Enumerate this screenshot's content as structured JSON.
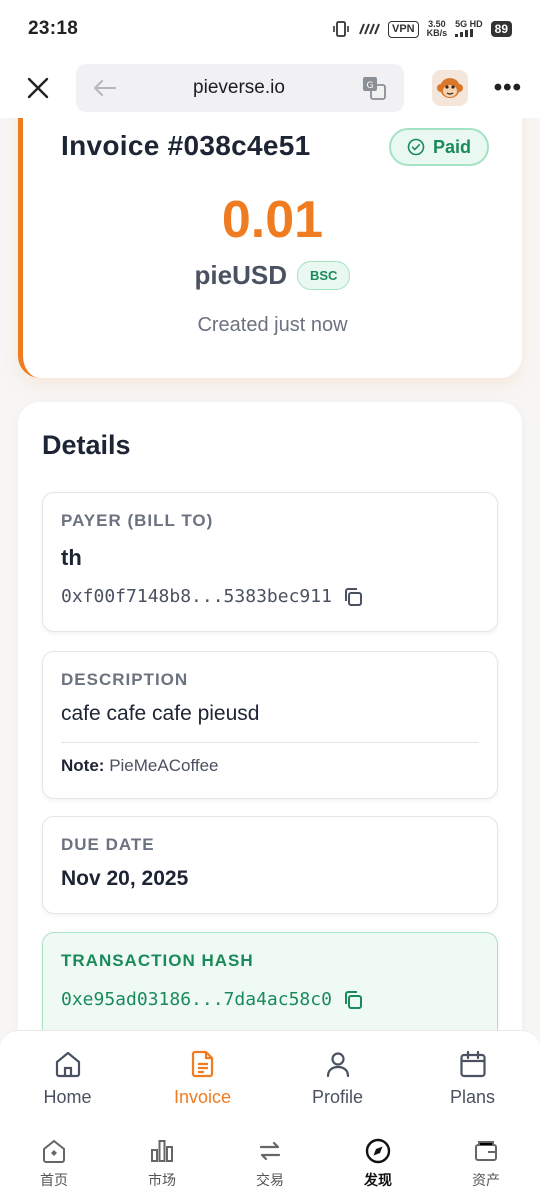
{
  "status_bar": {
    "time": "23:18",
    "net_speed_top": "3.50",
    "net_speed_bottom": "KB/s",
    "vpn": "VPN",
    "signal": "5G HD",
    "battery": "89"
  },
  "browser": {
    "url": "pieverse.io"
  },
  "invoice": {
    "title": "Invoice #038c4e51",
    "status": "Paid",
    "amount": "0.01",
    "currency": "pieUSD",
    "chain": "BSC",
    "created": "Created just now"
  },
  "details": {
    "title": "Details",
    "payer": {
      "label": "PAYER (BILL TO)",
      "name": "th",
      "address": "0xf00f7148b8...5383bec911"
    },
    "description": {
      "label": "DESCRIPTION",
      "text": "cafe cafe cafe pieusd",
      "note_label": "Note:",
      "note": "PieMeACoffee"
    },
    "due_date": {
      "label": "DUE DATE",
      "value": "Nov 20, 2025"
    },
    "tx_hash": {
      "label": "TRANSACTION HASH",
      "value": "0xe95ad03186...7da4ac58c0"
    }
  },
  "app_tabs": [
    {
      "label": "Home",
      "icon": "home-icon",
      "active": false
    },
    {
      "label": "Invoice",
      "icon": "document-icon",
      "active": true
    },
    {
      "label": "Profile",
      "icon": "person-icon",
      "active": false
    },
    {
      "label": "Plans",
      "icon": "calendar-icon",
      "active": false
    }
  ],
  "system_nav": [
    {
      "label": "首页",
      "icon": "home-icon"
    },
    {
      "label": "市场",
      "icon": "bar-chart-icon"
    },
    {
      "label": "交易",
      "icon": "swap-icon"
    },
    {
      "label": "发现",
      "icon": "compass-icon",
      "active": true
    },
    {
      "label": "资产",
      "icon": "wallet-icon"
    }
  ],
  "colors": {
    "accent": "#f07c22",
    "success": "#1a8a5a",
    "success_bg": "#e9f8f1"
  }
}
